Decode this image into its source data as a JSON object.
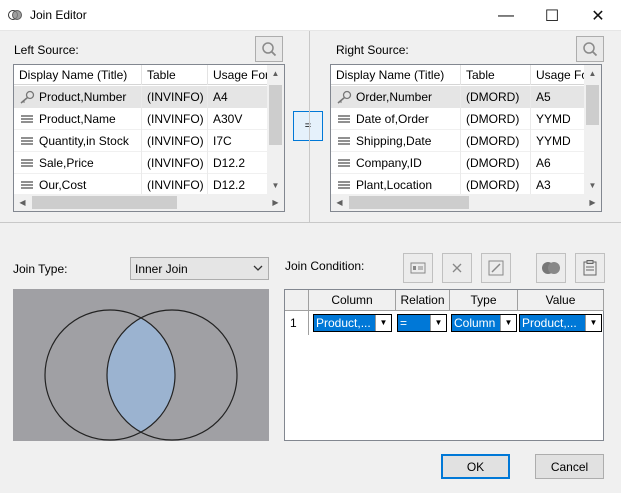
{
  "window": {
    "title": "Join Editor",
    "minimize": "—",
    "maximize": "☐",
    "close": "✕"
  },
  "left": {
    "label": "Left Source:",
    "columns": [
      "Display Name (Title)",
      "Table",
      "Usage Format"
    ],
    "rows": [
      {
        "name": "Product,Number",
        "table": "(INVINFO)",
        "format": "A4",
        "icon": "key-icon"
      },
      {
        "name": "Product,Name",
        "table": "(INVINFO)",
        "format": "A30V",
        "icon": "field-icon"
      },
      {
        "name": "Quantity,in Stock",
        "table": "(INVINFO)",
        "format": "I7C",
        "icon": "field-icon"
      },
      {
        "name": "Sale,Price",
        "table": "(INVINFO)",
        "format": "D12.2",
        "icon": "field-icon"
      },
      {
        "name": "Our,Cost",
        "table": "(INVINFO)",
        "format": "D12.2",
        "icon": "field-icon"
      }
    ]
  },
  "right": {
    "label": "Right Source:",
    "columns": [
      "Display Name (Title)",
      "Table",
      "Usage Format"
    ],
    "rows": [
      {
        "name": "Order,Number",
        "table": "(DMORD)",
        "format": "A5",
        "icon": "key-icon"
      },
      {
        "name": "Date of,Order",
        "table": "(DMORD)",
        "format": "YYMD",
        "icon": "field-icon"
      },
      {
        "name": "Shipping,Date",
        "table": "(DMORD)",
        "format": "YYMD",
        "icon": "field-icon"
      },
      {
        "name": "Company,ID",
        "table": "(DMORD)",
        "format": "A6",
        "icon": "field-icon"
      },
      {
        "name": "Plant,Location",
        "table": "(DMORD)",
        "format": "A3",
        "icon": "field-icon"
      }
    ]
  },
  "equal_button": "=",
  "join_type": {
    "label": "Join Type:",
    "value": "Inner Join"
  },
  "join_condition": {
    "label": "Join Condition:",
    "columns": [
      "Column",
      "Relation",
      "Type",
      "Value"
    ],
    "rows": [
      {
        "num": "1",
        "column": "Product,...",
        "relation": "=",
        "type": "Column",
        "value": "Product,..."
      }
    ]
  },
  "buttons": {
    "ok": "OK",
    "cancel": "Cancel"
  },
  "colors": {
    "accent": "#0078d7",
    "venn_bg": "#a0a0a4",
    "venn_overlap": "#9bb3d0"
  }
}
